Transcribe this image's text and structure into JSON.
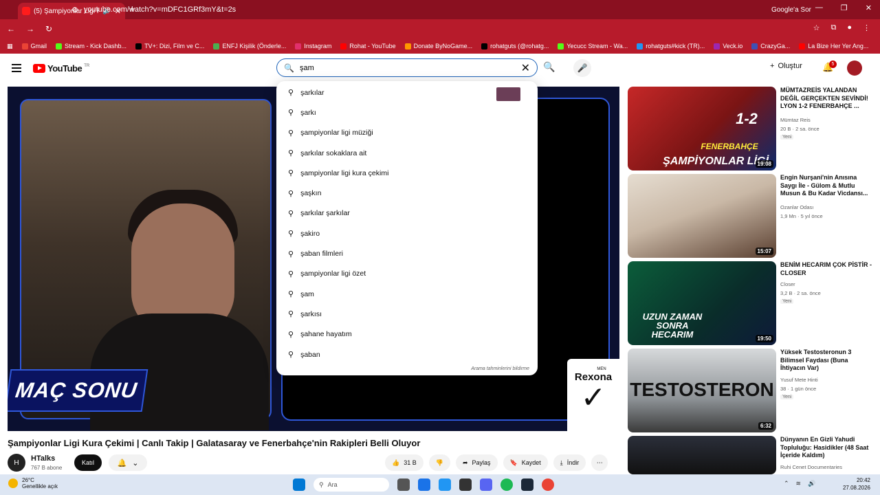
{
  "browser": {
    "tab_title": "(5) Şampiyonlar Ligi Kura Ç",
    "url": "youtube.com/watch?v=mDFC1GRf3mY&t=2s",
    "google_sor": "Google'a Sor",
    "bookmarks": [
      "Gmail",
      "Stream - Kick Dashb...",
      "TV+: Dizi, Film ve C...",
      "ENFJ Kişilik (Önderle...",
      "Instagram",
      "Rohat - YouTube",
      "Donate ByNoGame...",
      "rohatguts (@rohatg...",
      "Yecucc Stream - Wa...",
      "rohatguts#kick (TR)...",
      "Veck.io",
      "CrazyGa...",
      "La Bize Her Yer Ang..."
    ]
  },
  "youtube": {
    "logo_text": "YouTube",
    "logo_region": "TR",
    "search_value": "şam",
    "create_label": "Oluştur",
    "notification_count": "5"
  },
  "suggestions": [
    "şarkılar",
    "şarkı",
    "şampiyonlar ligi müziği",
    "şarkılar sokaklara ait",
    "şampiyonlar ligi kura çekimi",
    "şaşkın",
    "şarkılar şarkılar",
    "şakiro",
    "şaban filmleri",
    "şampiyonlar ligi özet",
    "şam",
    "şarkısı",
    "şahane hayatım",
    "şaban"
  ],
  "suggest_footer": "Arama tahminlerini bildirme",
  "video": {
    "overlay_text": "MAÇ SONU",
    "sponsor_men": "MEN",
    "sponsor_brand": "Rexona",
    "title": "Şampiyonlar Ligi Kura Çekimi | Canlı Takip | Galatasaray ve Fenerbahçe'nin Rakipleri Belli Oluyor",
    "channel": "HTalks",
    "subscribers": "767 B abone",
    "join_label": "Katıl",
    "likes": "31 B",
    "share_label": "Paylaş",
    "save_label": "Kaydet",
    "download_label": "İndir"
  },
  "sidebar": [
    {
      "title": "MÜMTAZREİS YALANDAN DEĞİL GERÇEKTEN SEVİNDİ! LYON 1-2 FENERBAHÇE ...",
      "channel": "Mümtaz Reis",
      "meta": "20 B · 2 sa. önce",
      "new": "Yeni",
      "duration": "19:08",
      "thumb_text": "ŞAMPİYONLAR LİGİ",
      "score": "1-2",
      "team": "FENERBAHÇE"
    },
    {
      "title": "Engin Nurşani'nin Anısına Saygı İle - Gülom & Mutlu Musun & Bu Kadar Vicdansı...",
      "channel": "Ozanlar Odası",
      "meta": "1,9 Mn · 5 yıl önce",
      "new": "",
      "duration": "15:07",
      "thumb_text": ""
    },
    {
      "title": "BENİM HECARIM ÇOK PİSTİR - CLOSER",
      "channel": "Closer",
      "meta": "3,2 B · 2 sa. önce",
      "new": "Yeni",
      "duration": "19:50",
      "thumb_text": "UZUN ZAMAN SONRA HECARIM"
    },
    {
      "title": "Yüksek Testosteronun 3 Bilimsel Faydası (Buna İhtiyacın Var)",
      "channel": "Yusuf Mete Hinti",
      "meta": "38 · 1 gün önce",
      "new": "Yeni",
      "duration": "6:32",
      "thumb_text": "TESTOSTERON"
    },
    {
      "title": "Dünyanın En Gizli Yahudi Topluluğu: Hasidikler (48 Saat İçeride Kaldım)",
      "channel": "Ruhi Cenet Documentaries",
      "meta": "",
      "new": "",
      "duration": "",
      "thumb_text": ""
    }
  ],
  "taskbar": {
    "temp": "26°C",
    "weather": "Genellikle açık",
    "search": "Ara",
    "time": "20:42",
    "date": "27.08.2026"
  }
}
